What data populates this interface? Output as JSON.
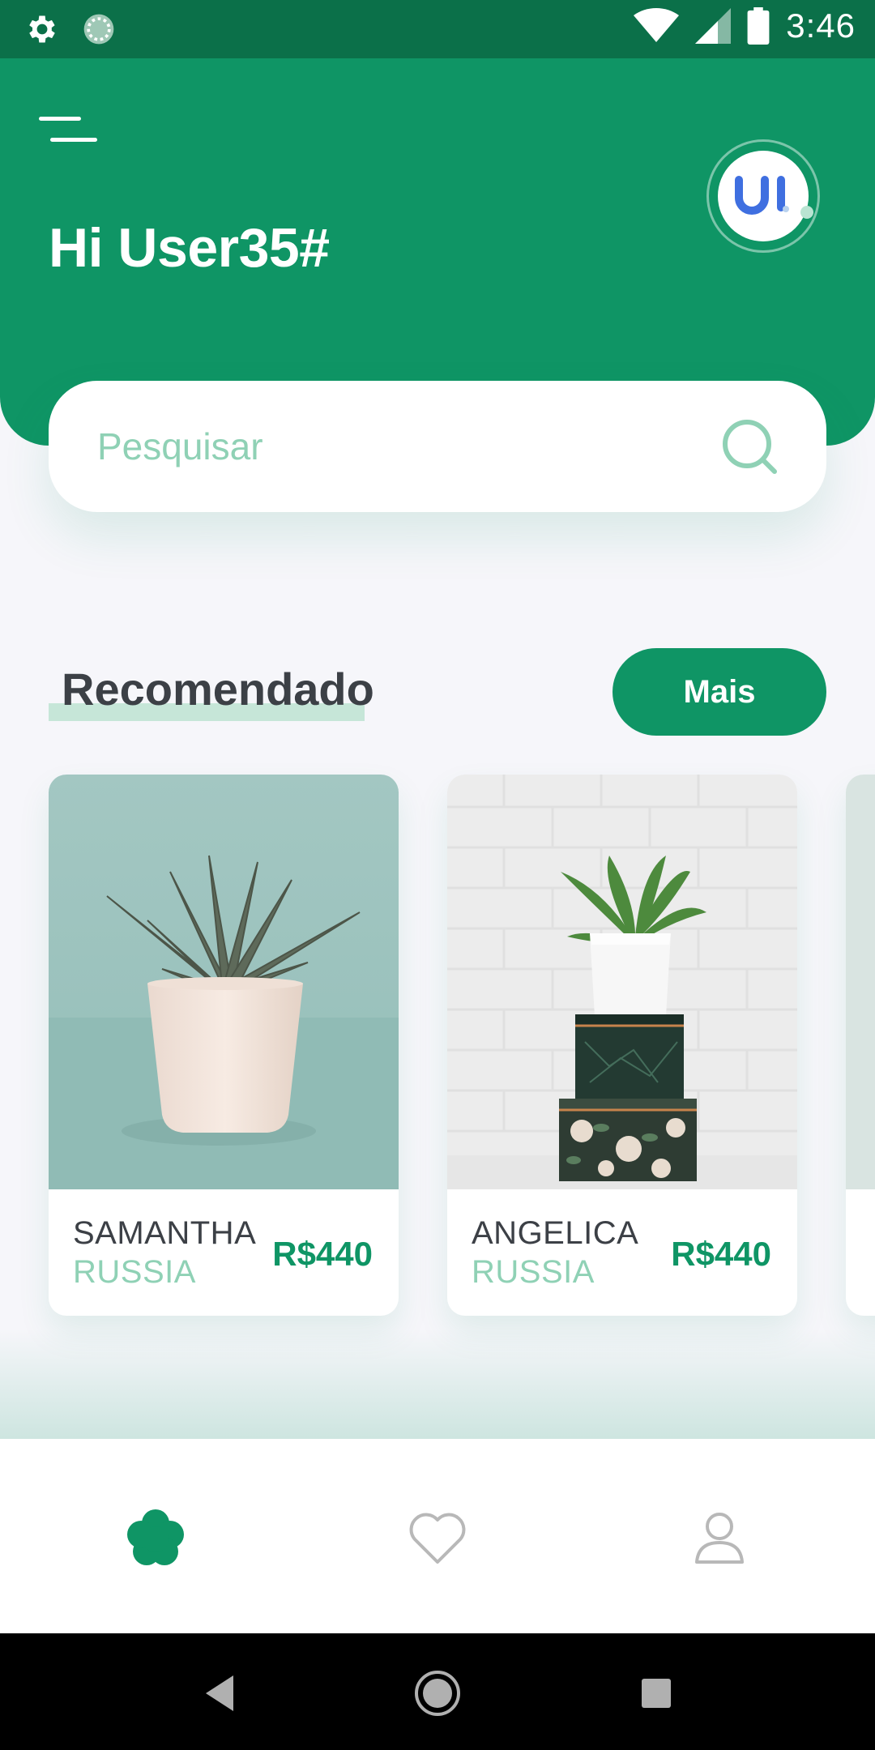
{
  "status_bar": {
    "time": "3:46",
    "icons": [
      "settings-icon",
      "sync-icon",
      "wifi-icon",
      "signal-icon",
      "battery-icon"
    ]
  },
  "header": {
    "greeting": "Hi User35#",
    "menu_icon": "menu-icon",
    "avatar_icon": "avatar-logo-icon"
  },
  "search": {
    "placeholder": "Pesquisar",
    "value": ""
  },
  "recommended": {
    "title": "Recomendado",
    "more_label": "Mais",
    "items": [
      {
        "name": "SAMANTHA",
        "country": "RUSSIA",
        "price": "R$440",
        "image": "aloe-plant-photo"
      },
      {
        "name": "ANGELICA",
        "country": "RUSSIA",
        "price": "R$440",
        "image": "snake-plant-boxes-photo"
      }
    ]
  },
  "bottom_nav": {
    "items": [
      "flower-icon",
      "heart-icon",
      "user-icon"
    ],
    "active": "flower-icon"
  },
  "system_nav": {
    "items": [
      "back-icon",
      "home-icon",
      "recents-icon"
    ]
  },
  "colors": {
    "primary": "#0f9565",
    "status_bar": "#0b7049",
    "accent_light": "#8fd1b5",
    "text_dark": "#3c4046",
    "background": "#f6f6fa"
  }
}
